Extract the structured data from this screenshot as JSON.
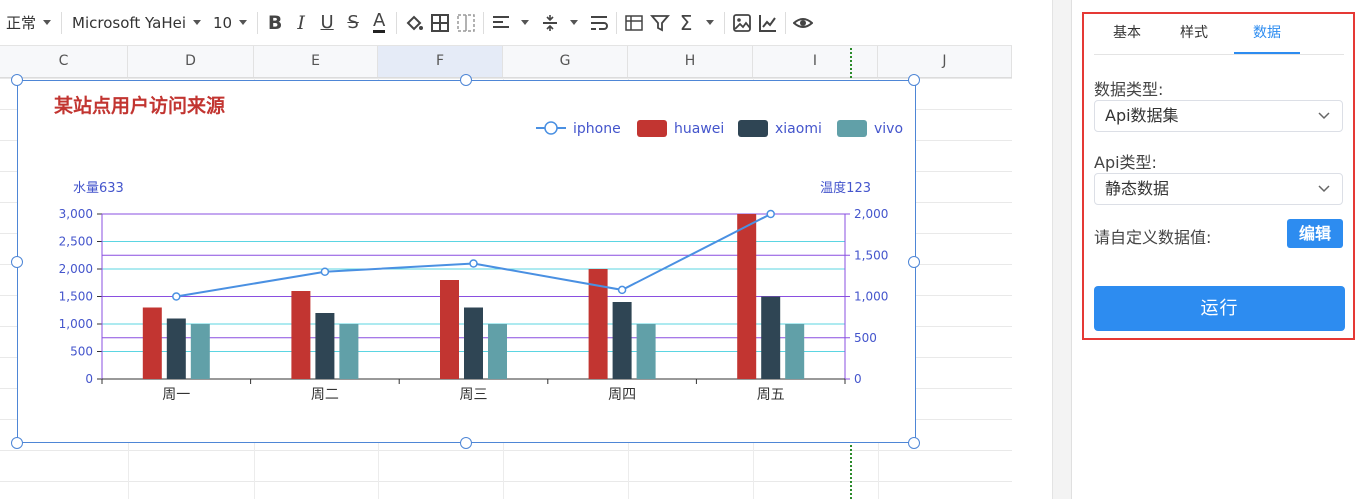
{
  "toolbar": {
    "style_select": "正常",
    "font_select": "Microsoft YaHei",
    "size_select": "10",
    "icons": [
      "bold-icon",
      "italic-icon",
      "underline-icon",
      "strikethrough-icon",
      "font-color-icon",
      "fill-color-icon",
      "border-icon",
      "merge-cells-icon",
      "align-left-icon",
      "valign-icon",
      "wrap-text-icon",
      "freeze-icon",
      "filter-icon",
      "sum-icon",
      "image-icon",
      "chart-icon",
      "preview-icon"
    ]
  },
  "sheet": {
    "columns": [
      "C",
      "D",
      "E",
      "F",
      "G",
      "H",
      "I",
      "J"
    ],
    "selected_column": "F"
  },
  "chart_data": {
    "type": "bar",
    "title": "某站点用户访问来源",
    "categories": [
      "周一",
      "周二",
      "周三",
      "周四",
      "周五"
    ],
    "series": [
      {
        "name": "iphone",
        "type": "line",
        "axis": "right",
        "values": [
          1000,
          1300,
          1400,
          1080,
          2000
        ]
      },
      {
        "name": "huawei",
        "type": "bar",
        "axis": "left",
        "values": [
          1300,
          1600,
          1800,
          2000,
          3000
        ]
      },
      {
        "name": "xiaomi",
        "type": "bar",
        "axis": "left",
        "values": [
          1100,
          1200,
          1300,
          1400,
          1500
        ]
      },
      {
        "name": "vivo",
        "type": "bar",
        "axis": "left",
        "values": [
          1000,
          1000,
          1000,
          1000,
          1000
        ]
      }
    ],
    "ylabel": "水量633",
    "ylabel_right": "温度123",
    "ylim": [
      0,
      3000
    ],
    "yticks": [
      "3,000",
      "2,500",
      "2,000",
      "1,500",
      "1,000",
      "500",
      "0"
    ],
    "ylim_right": [
      0,
      2000
    ],
    "yticks_right": [
      "2,000",
      "1,500",
      "1,000",
      "500",
      "0"
    ],
    "legend_placement": "top-right",
    "grid": true,
    "colors": {
      "iphone": "#4a90e2",
      "huawei": "#c23531",
      "xiaomi": "#2f4554",
      "vivo": "#61a0a8",
      "title": "#c23531",
      "axis_text": "#4455cc",
      "grid_cyan": "#5bd5e2",
      "grid_purple": "#8a4fe0"
    }
  },
  "panel": {
    "tabs": [
      "基本",
      "样式",
      "数据"
    ],
    "active_tab": "数据",
    "data_type_label": "数据类型:",
    "data_type_value": "Api数据集",
    "api_type_label": "Api类型:",
    "api_type_value": "静态数据",
    "custom_label": "请自定义数据值:",
    "edit_button": "编辑",
    "run_button": "运行"
  }
}
